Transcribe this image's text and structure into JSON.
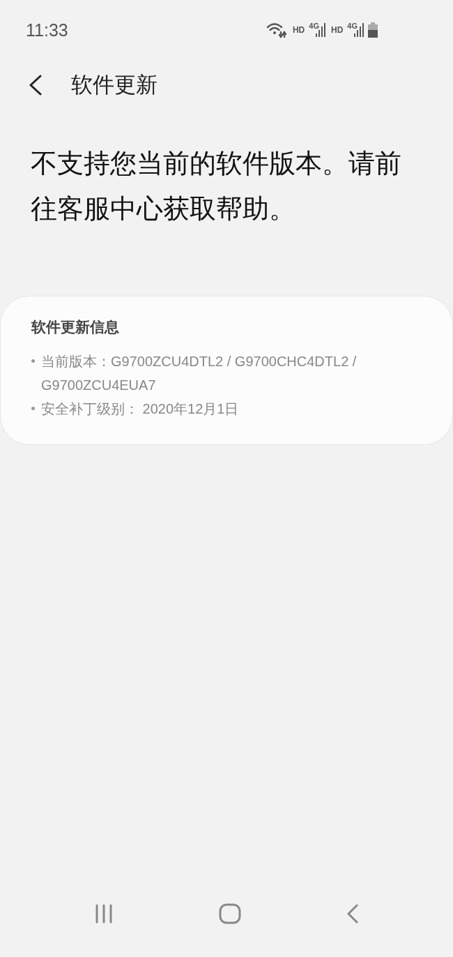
{
  "status_bar": {
    "time": "11:33",
    "indicators": [
      "HD",
      "4G",
      "HD",
      "4G"
    ]
  },
  "header": {
    "title": "软件更新"
  },
  "message": "不支持您当前的软件版本。请前往客服中心获取帮助。",
  "info_card": {
    "title": "软件更新信息",
    "items": [
      "当前版本：G9700ZCU4DTL2 / G9700CHC4DTL2 / G9700ZCU4EUA7",
      "安全补丁级别： 2020年12月1日"
    ]
  }
}
